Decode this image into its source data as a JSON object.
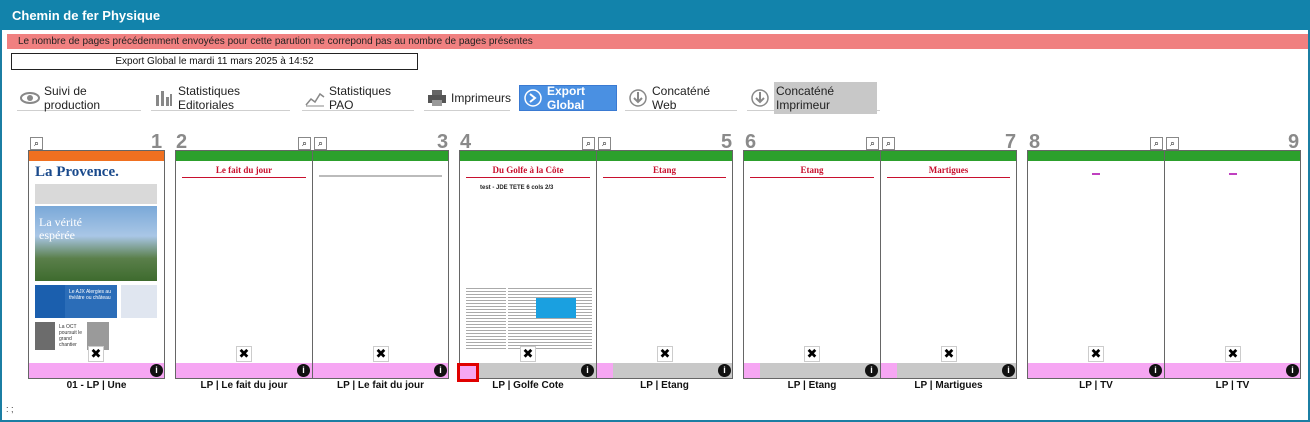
{
  "window": {
    "title": "Chemin de fer Physique"
  },
  "alert": {
    "message": "Le nombre de pages précédemment envoyées pour cette parution ne correpond pas au nombre de pages présentes"
  },
  "export": {
    "text": "Export Global le mardi 11 mars 2025 à 14:52"
  },
  "toolbar": {
    "suivi": "Suivi de production",
    "stats_edito": "Statistiques Editoriales",
    "stats_pao": "Statistiques PAO",
    "imprimeurs": "Imprimeurs",
    "export_global": "Export Global",
    "concat_web": "Concaténé Web",
    "concat_imprimeur": "Concaténé Imprimeur"
  },
  "colors": {
    "orange": "#f07020",
    "green": "#2ca02c",
    "pink": "#f6a6f3",
    "gray": "#c8c8c8",
    "accent": "#1283ab"
  },
  "pages": [
    {
      "number": "1",
      "caption": "01 - LP | Une",
      "band": "orange",
      "rubric": ""
    },
    {
      "number": "2",
      "caption": "LP | Le fait du jour",
      "band": "green",
      "rubric": "Le fait du jour"
    },
    {
      "number": "3",
      "caption": "LP | Le fait du jour",
      "band": "green",
      "rubric": ""
    },
    {
      "number": "4",
      "caption": "LP | Golfe Cote",
      "band": "green",
      "rubric": "Du Golfe à la Côte",
      "subtitle": "test - JDE TETE 6 cols 2/3"
    },
    {
      "number": "5",
      "caption": "LP | Etang",
      "band": "green",
      "rubric": "Etang"
    },
    {
      "number": "6",
      "caption": "LP | Etang",
      "band": "green",
      "rubric": "Etang"
    },
    {
      "number": "7",
      "caption": "LP | Martigues",
      "band": "green",
      "rubric": "Martigues"
    },
    {
      "number": "8",
      "caption": "LP | TV",
      "band": "green",
      "rubric": ""
    },
    {
      "number": "9",
      "caption": "LP | TV",
      "band": "green",
      "rubric": ""
    }
  ],
  "front": {
    "masthead": "La Provence.",
    "headline": "La vérité espérée",
    "teaser": "Le AJX Alergies au théâtre ou château",
    "small": "La OCT poursuit le grand chantier"
  },
  "footer": {
    "text": ": ;"
  }
}
